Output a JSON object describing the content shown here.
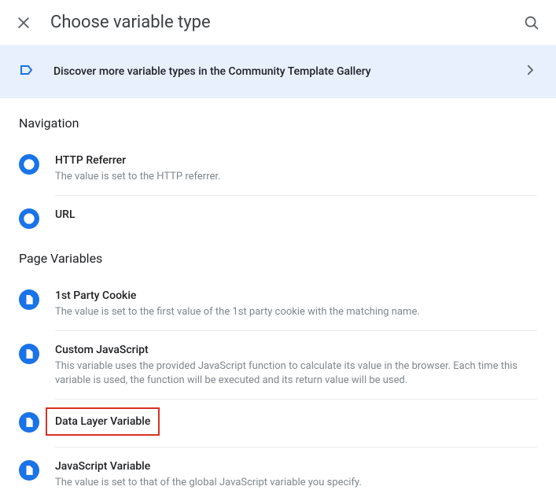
{
  "header": {
    "title": "Choose variable type"
  },
  "banner": {
    "text": "Discover more variable types in the Community Template Gallery"
  },
  "sections": [
    {
      "title": "Navigation",
      "items": [
        {
          "icon": "globe",
          "title": "HTTP Referrer",
          "desc": "The value is set to the HTTP referrer.",
          "highlighted": false
        },
        {
          "icon": "globe",
          "title": "URL",
          "desc": "",
          "highlighted": false
        }
      ]
    },
    {
      "title": "Page Variables",
      "items": [
        {
          "icon": "doc",
          "title": "1st Party Cookie",
          "desc": "The value is set to the first value of the 1st party cookie with the matching name.",
          "highlighted": false
        },
        {
          "icon": "doc",
          "title": "Custom JavaScript",
          "desc": "This variable uses the provided JavaScript function to calculate its value in the browser. Each time this variable is used, the function will be executed and its return value will be used.",
          "highlighted": false
        },
        {
          "icon": "doc",
          "title": "Data Layer Variable",
          "desc": "",
          "highlighted": true
        },
        {
          "icon": "doc",
          "title": "JavaScript Variable",
          "desc": "The value is set to that of the global JavaScript variable you specify.",
          "highlighted": false
        }
      ]
    }
  ]
}
